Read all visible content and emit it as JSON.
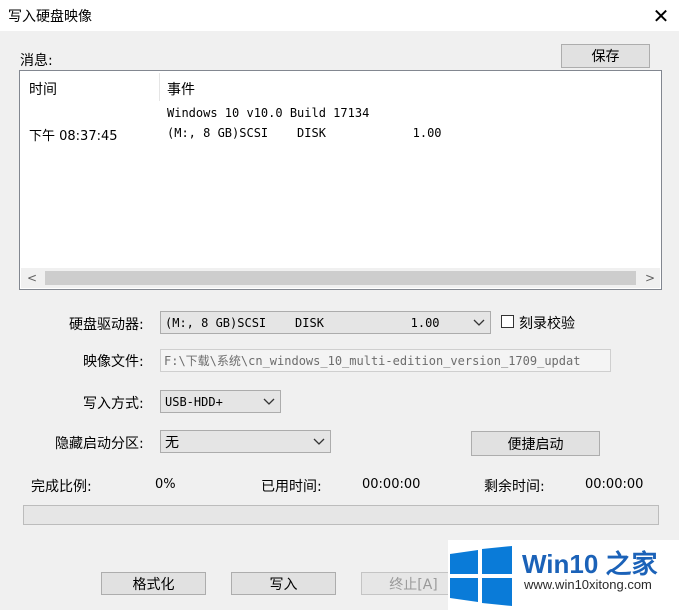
{
  "window": {
    "title": "写入硬盘映像",
    "close_glyph": "✕"
  },
  "messages": {
    "label": "消息:",
    "save_button": "保存",
    "columns": {
      "time": "时间",
      "event": "事件"
    },
    "rows": [
      {
        "time": "",
        "event": "Windows 10 v10.0 Build 17134"
      },
      {
        "time": "下午 08:37:45",
        "event": "(M:, 8 GB)SCSI    DISK            1.00"
      }
    ],
    "scroll_left": "<",
    "scroll_right": ">"
  },
  "form": {
    "drive_label": "硬盘驱动器:",
    "drive_value": "(M:, 8 GB)SCSI    DISK            1.00",
    "verify_label": "刻录校验",
    "verify_checked": false,
    "image_file_label": "映像文件:",
    "image_file_value": "F:\\下载\\系统\\cn_windows_10_multi-edition_version_1709_updat",
    "write_mode_label": "写入方式:",
    "write_mode_value": "USB-HDD+",
    "hidden_partition_label": "隐藏启动分区:",
    "hidden_partition_value": "无",
    "quick_boot_button": "便捷启动"
  },
  "status": {
    "progress_label": "完成比例:",
    "progress_value": "0%",
    "progress_fraction": 0,
    "elapsed_label": "已用时间:",
    "elapsed_value": "00:00:00",
    "remaining_label": "剩余时间:",
    "remaining_value": "00:00:00"
  },
  "buttons": {
    "format": "格式化",
    "write": "写入",
    "stop": "终止[A]"
  },
  "watermark": {
    "title": "Win10 之家",
    "url": "www.win10xitong.com"
  },
  "colors": {
    "logo_blue": "#0a7bd8",
    "watermark_text": "#1b62b8"
  }
}
